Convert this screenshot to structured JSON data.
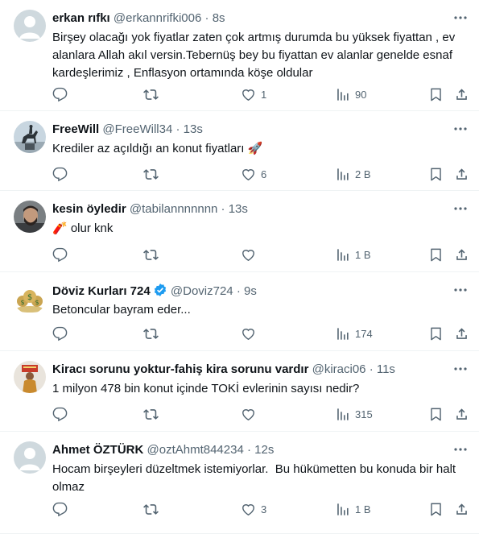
{
  "tweets": [
    {
      "name": "erkan rıfkı",
      "handle": "@erkannrifki006",
      "time": "8s",
      "text": "Birşey olacağı yok fiyatlar zaten çok artmış durumda bu yüksek fiyattan , ev alanlara Allah akıl versin.Tebernüş bey bu fiyattan ev alanlar genelde esnaf kardeşlerimiz , Enflasyon ortamında köşe oldular",
      "replies": "",
      "retweets": "",
      "likes": "1",
      "views": "90",
      "avatar": "default-avatar"
    },
    {
      "name": "FreeWill",
      "handle": "@FreeWill34",
      "time": "13s",
      "text": "Krediler az açıldığı an konut fiyatları 🚀",
      "replies": "",
      "retweets": "",
      "likes": "6",
      "views": "2 B",
      "avatar": "equestrian-statue-avatar"
    },
    {
      "name": "kesin öyledir",
      "handle": "@tabilannnnnnn",
      "time": "13s",
      "text": "🧨 olur knk",
      "replies": "",
      "retweets": "",
      "likes": "",
      "views": "1 B",
      "avatar": "man-with-beard-avatar"
    },
    {
      "name": "Döviz Kurları 724",
      "handle": "@Doviz724",
      "time": "9s",
      "text": "Betoncular bayram eder...",
      "replies": "",
      "retweets": "",
      "likes": "",
      "views": "174",
      "avatar": "money-bags-avatar",
      "verified": true
    },
    {
      "name": "Kiracı sorunu yoktur-fahiş kira sorunu vardır",
      "handle": "@kiraci06",
      "time": "11s",
      "text": "1 milyon 478 bin konut içinde TOKİ evlerinin sayısı nedir?",
      "replies": "",
      "retweets": "",
      "likes": "",
      "views": "315",
      "avatar": "sign-holder-avatar"
    },
    {
      "name": "Ahmet ÖZTÜRK",
      "handle": "@oztAhmt844234",
      "time": "12s",
      "text": "Hocam birşeyleri düzeltmek istemiyorlar.  Bu hükümetten bu konuda bir halt olmaz",
      "replies": "",
      "retweets": "",
      "likes": "3",
      "views": "1 B",
      "avatar": "default-avatar"
    }
  ],
  "separator": "·",
  "colors": {
    "muted": "#536471",
    "text": "#0f1419",
    "verified": "#1d9bf0",
    "border": "#eff3f4"
  }
}
